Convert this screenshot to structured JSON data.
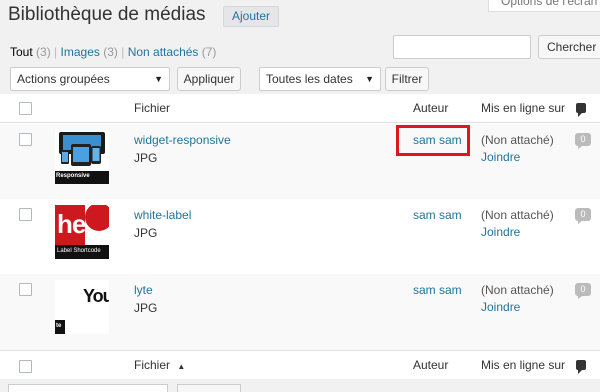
{
  "header": {
    "screen_options": "Options de l'écran",
    "title": "Bibliothèque de médias",
    "add_button": "Ajouter"
  },
  "filters": {
    "all": {
      "label": "Tout",
      "count": "(3)"
    },
    "images": {
      "label": "Images",
      "count": "(3)"
    },
    "unattached": {
      "label": "Non attachés",
      "count": "(7)"
    },
    "separator": "|"
  },
  "search": {
    "value": "",
    "button": "Chercher parmi les médias"
  },
  "toolbar": {
    "bulk_actions": "Actions groupées",
    "apply": "Appliquer",
    "dates": "Toutes les dates",
    "filter": "Filtrer"
  },
  "columns": {
    "file": "Fichier",
    "sort_indicator": "▲",
    "author": "Auteur",
    "uploaded_to": "Mis en ligne sur"
  },
  "rows": [
    {
      "title": "widget-responsive",
      "type": "JPG",
      "author": "sam sam",
      "attached": "(Non attaché)",
      "attach_link": "Joindre",
      "comments": "0",
      "thumb_label": "Responsive"
    },
    {
      "title": "white-label",
      "type": "JPG",
      "author": "sam sam",
      "attached": "(Non attaché)",
      "attach_link": "Joindre",
      "comments": "0",
      "thumb_label": "Label Shortcode",
      "thumb_glyph": "he"
    },
    {
      "title": "lyte",
      "type": "JPG",
      "author": "sam sam",
      "attached": "(Non attaché)",
      "attach_link": "Joindre",
      "comments": "0",
      "thumb_glyph": "You",
      "thumb_label": "te"
    }
  ],
  "colors": {
    "link": "#21759b",
    "highlight": "#e0161f",
    "youtube_red": "#cc181e"
  }
}
